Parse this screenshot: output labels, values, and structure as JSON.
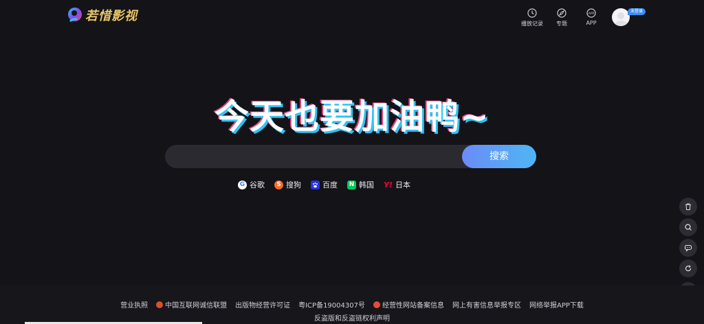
{
  "logo": {
    "text": "若惜影视"
  },
  "nav": {
    "history": "播放记录",
    "topics": "专题",
    "app": "APP",
    "app_icon_text": "APP"
  },
  "user": {
    "login_badge": "未登录"
  },
  "hero": {
    "title": "今天也要加油鸭~"
  },
  "search": {
    "placeholder": "",
    "button": "搜索"
  },
  "engines": [
    {
      "label": "谷歌",
      "icon": "google-icon",
      "color": "#4285f4"
    },
    {
      "label": "搜狗",
      "icon": "sogou-icon",
      "color": "#f36c21"
    },
    {
      "label": "百度",
      "icon": "baidu-icon",
      "color": "#2932e1"
    },
    {
      "label": "韩国",
      "icon": "naver-icon",
      "color": "#03c75a"
    },
    {
      "label": "日本",
      "icon": "yahoo-icon",
      "color": "#ff0033"
    }
  ],
  "footer": {
    "links": [
      "营业执照",
      "中国互联网诚信联盟",
      "出版物经营许可证",
      "粤ICP备19004307号",
      "经营性网站备案信息",
      "网上有害信息举报专区",
      "网络举报APP下载"
    ],
    "line2": "反盗版和反盗链权利声明"
  },
  "colors": {
    "background": "#141318",
    "accent": "#4fb6f5",
    "title_shadow_cyan": "#2ec4f4",
    "title_shadow_pink": "#e0437e"
  }
}
